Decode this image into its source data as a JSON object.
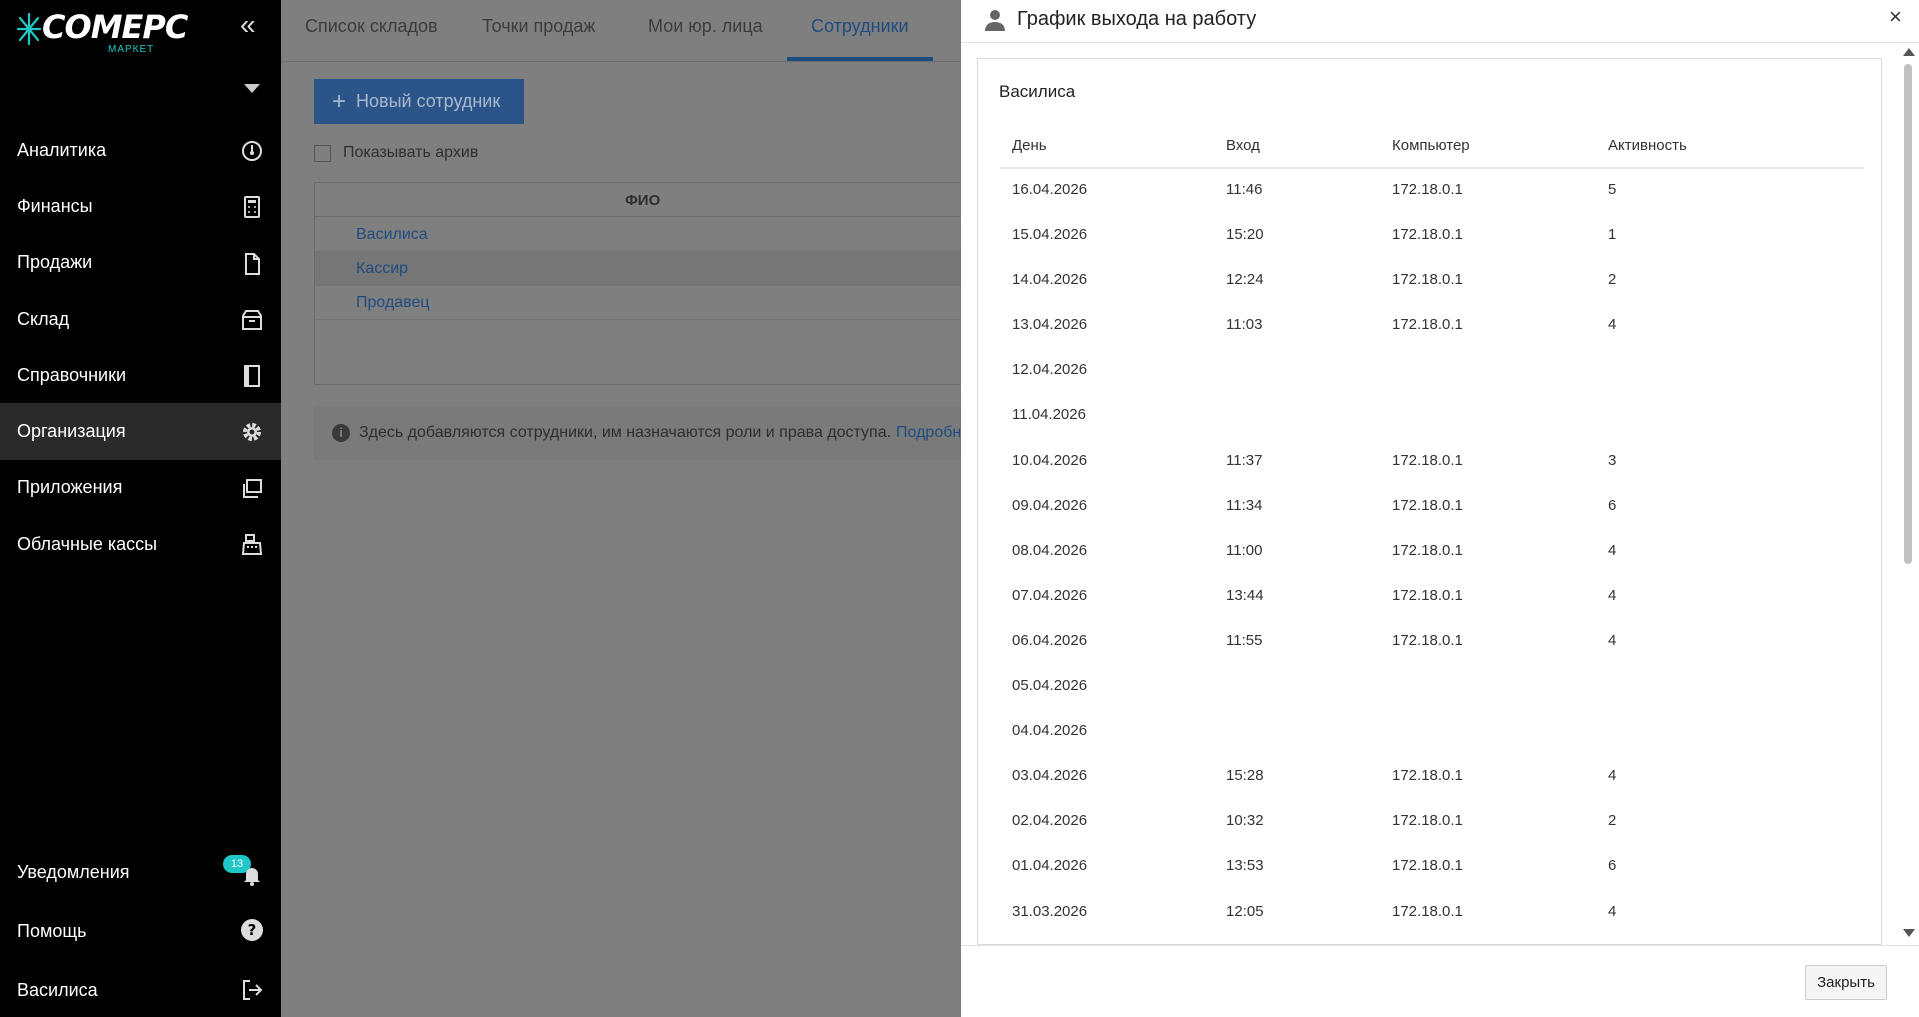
{
  "sidebar": {
    "logo_text": "COMEPC",
    "logo_sub": "МАРКЕТ",
    "collapse_glyph": "«",
    "items": [
      {
        "label": "Аналитика",
        "icon": "gauge-icon"
      },
      {
        "label": "Финансы",
        "icon": "calculator-icon"
      },
      {
        "label": "Продажи",
        "icon": "document-icon"
      },
      {
        "label": "Склад",
        "icon": "box-icon"
      },
      {
        "label": "Справочники",
        "icon": "book-icon"
      },
      {
        "label": "Организация",
        "icon": "gear-icon",
        "active": true
      },
      {
        "label": "Приложения",
        "icon": "windows-icon"
      },
      {
        "label": "Облачные кассы",
        "icon": "cash-register-icon"
      }
    ],
    "bottom": {
      "notifications": {
        "label": "Уведомления",
        "count": "13"
      },
      "help": {
        "label": "Помощь"
      },
      "user": {
        "label": "Василиса"
      }
    }
  },
  "main": {
    "tabs": [
      "Список складов",
      "Точки продаж",
      "Мои юр. лица",
      "Сотрудники"
    ],
    "active_tab": "Сотрудники",
    "new_button": {
      "plus": "+",
      "label": "Новый сотрудник"
    },
    "show_archive": "Показывать архив",
    "table_header": "ФИО",
    "employees": [
      "Василиса",
      "Кассир",
      "Продавец"
    ],
    "info_text": "Здесь добавляются сотрудники, им назначаются роли и права доступа.",
    "info_link": "Подробнее",
    "info_icon_glyph": "i"
  },
  "modal": {
    "title": "График выхода на работу",
    "close_glyph": "×",
    "employee": "Василиса",
    "columns": [
      "День",
      "Вход",
      "Компьютер",
      "Активность"
    ],
    "rows": [
      [
        "16.04.2026",
        "11:46",
        "172.18.0.1",
        "5"
      ],
      [
        "15.04.2026",
        "15:20",
        "172.18.0.1",
        "1"
      ],
      [
        "14.04.2026",
        "12:24",
        "172.18.0.1",
        "2"
      ],
      [
        "13.04.2026",
        "11:03",
        "172.18.0.1",
        "4"
      ],
      [
        "12.04.2026",
        "",
        "",
        ""
      ],
      [
        "11.04.2026",
        "",
        "",
        ""
      ],
      [
        "10.04.2026",
        "11:37",
        "172.18.0.1",
        "3"
      ],
      [
        "09.04.2026",
        "11:34",
        "172.18.0.1",
        "6"
      ],
      [
        "08.04.2026",
        "11:00",
        "172.18.0.1",
        "4"
      ],
      [
        "07.04.2026",
        "13:44",
        "172.18.0.1",
        "4"
      ],
      [
        "06.04.2026",
        "11:55",
        "172.18.0.1",
        "4"
      ],
      [
        "05.04.2026",
        "",
        "",
        ""
      ],
      [
        "04.04.2026",
        "",
        "",
        ""
      ],
      [
        "03.04.2026",
        "15:28",
        "172.18.0.1",
        "4"
      ],
      [
        "02.04.2026",
        "10:32",
        "172.18.0.1",
        "2"
      ],
      [
        "01.04.2026",
        "13:53",
        "172.18.0.1",
        "6"
      ],
      [
        "31.03.2026",
        "12:05",
        "172.18.0.1",
        "4"
      ]
    ],
    "close_button": "Закрыть"
  },
  "colors": {
    "sidebar_bg": "#000000",
    "accent_teal": "#1ec8c8",
    "overlay_bg": "#7f7f7f",
    "active_tab": "#1f4c80"
  }
}
